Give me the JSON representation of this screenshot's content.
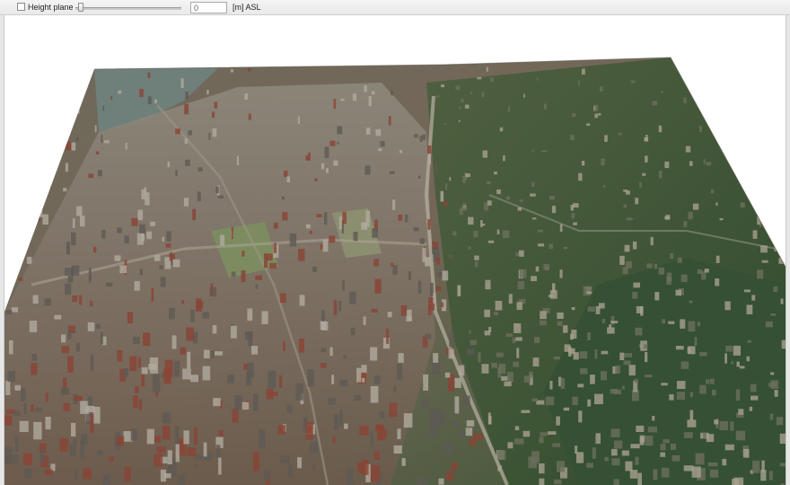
{
  "toolbar": {
    "height_plane": {
      "label": "Height plane",
      "checked": false
    },
    "slider": {
      "value_fraction": 0.03
    },
    "height_input": {
      "value": "0"
    },
    "unit_label": "[m] ASL"
  },
  "viewport": {
    "scene": "3d-city-terrain-model",
    "colors": {
      "background": "#ffffff",
      "vegetation": "#3f5a34",
      "urban": "#7a6e60",
      "roof_red": "#8a4434",
      "water": "#6e7f7a"
    }
  }
}
